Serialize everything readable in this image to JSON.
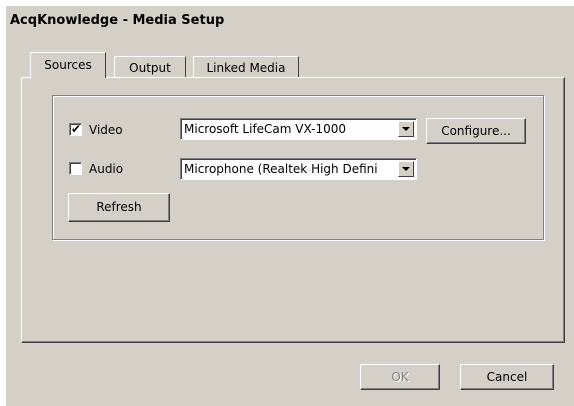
{
  "window": {
    "title": "AcqKnowledge - Media Setup"
  },
  "tabs": [
    {
      "label": "Sources",
      "active": true
    },
    {
      "label": "Output",
      "active": false
    },
    {
      "label": "Linked Media",
      "active": false
    }
  ],
  "sources": {
    "video": {
      "label": "Video",
      "checked": true,
      "device": "Microsoft LifeCam VX-1000"
    },
    "audio": {
      "label": "Audio",
      "checked": false,
      "device": "Microphone (Realtek High Defini"
    },
    "configure_label": "Configure...",
    "refresh_label": "Refresh"
  },
  "footer": {
    "ok_label": "OK",
    "ok_enabled": false,
    "cancel_label": "Cancel"
  },
  "colors": {
    "dialog_face": "#d4d0c8",
    "disabled_text": "#808080"
  },
  "icons": {
    "check": "✔",
    "dropdown": "chevron-down-icon"
  }
}
